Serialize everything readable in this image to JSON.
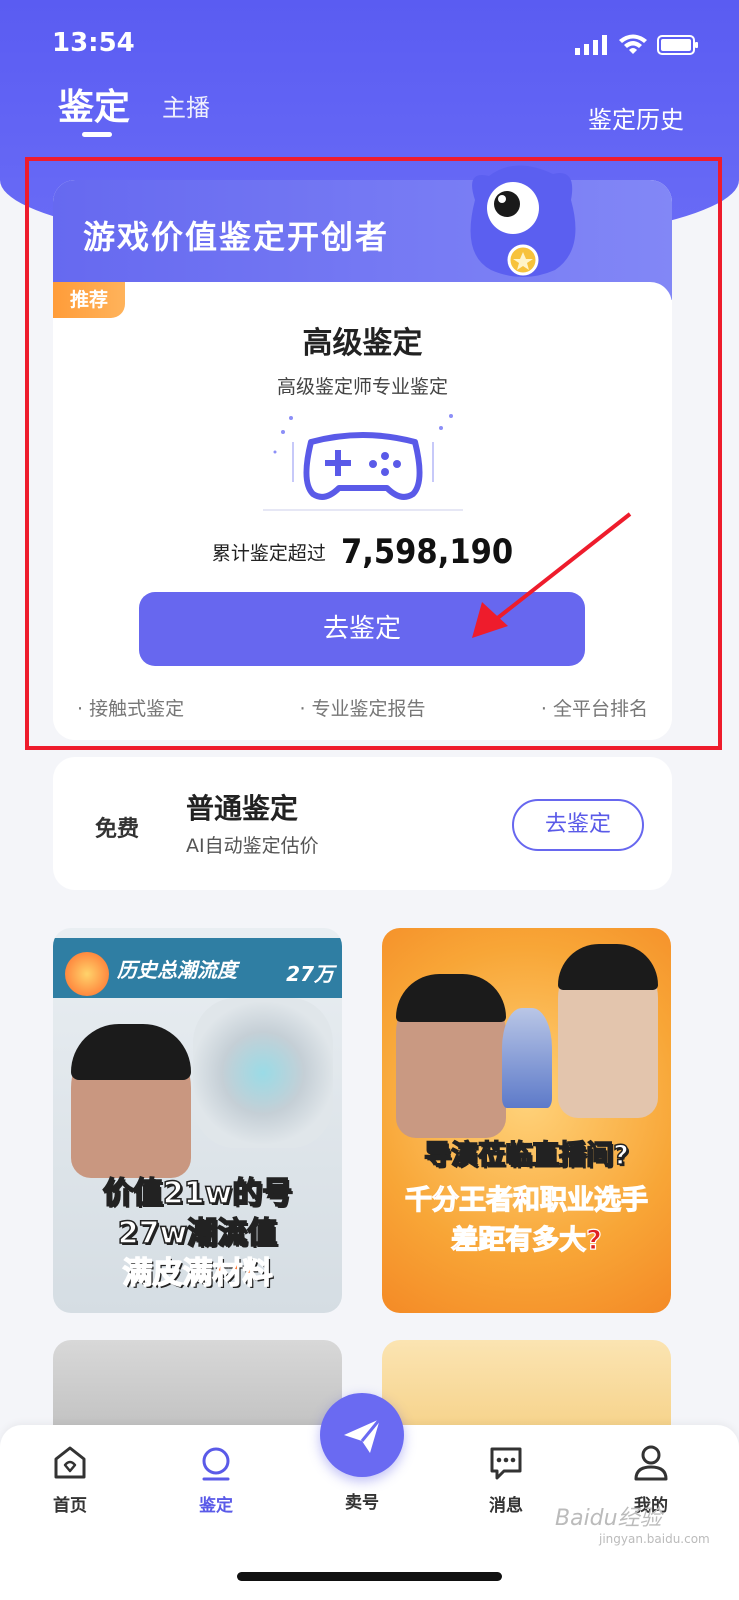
{
  "status": {
    "time": "13:54"
  },
  "nav": {
    "tab_main": "鉴定",
    "tab_sub": "主播",
    "history": "鉴定历史"
  },
  "premium": {
    "banner": "游戏价值鉴定开创者",
    "badge": "推荐",
    "title": "高级鉴定",
    "subtitle": "高级鉴定师专业鉴定",
    "count_label": "累计鉴定超过",
    "count_value": "7,598,190",
    "button": "去鉴定",
    "features": [
      "· 接触式鉴定",
      "· 专业鉴定报告",
      "· 全平台排名"
    ]
  },
  "normal": {
    "free": "免费",
    "title": "普通鉴定",
    "subtitle": "AI自动鉴定估价",
    "button": "去鉴定"
  },
  "cards": [
    {
      "head": "历史总潮流度",
      "head_num": "27万",
      "lines": [
        "价值21w的号",
        "27w潮流值",
        "满皮满材料"
      ]
    },
    {
      "lines": [
        "导演莅临直播间?",
        "千分王者和职业选手",
        "差距有多大?"
      ]
    }
  ],
  "tabbar": {
    "items": [
      {
        "label": "首页",
        "icon": "home-icon"
      },
      {
        "label": "鉴定",
        "icon": "appraise-icon",
        "active": true
      },
      {
        "label": "卖号",
        "icon": "send-icon"
      },
      {
        "label": "消息",
        "icon": "message-icon"
      },
      {
        "label": "我的",
        "icon": "profile-icon"
      }
    ]
  },
  "watermark": {
    "main": "Baidu经验",
    "sub": "jingyan.baidu.com"
  },
  "colors": {
    "accent": "#6767ef",
    "highlight": "#ee1c2c",
    "badge": "#ff9c39"
  }
}
